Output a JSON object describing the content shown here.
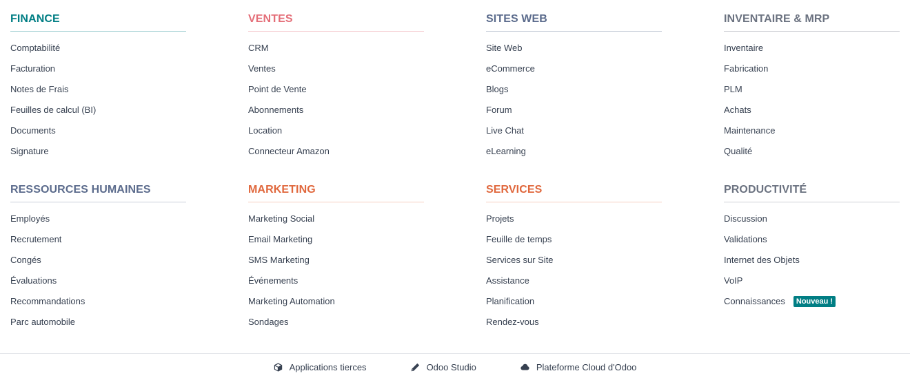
{
  "sections": [
    {
      "title": "FINANCE",
      "color": "#017e84",
      "items": [
        "Comptabilité",
        "Facturation",
        "Notes de Frais",
        "Feuilles de calcul (BI)",
        "Documents",
        "Signature"
      ]
    },
    {
      "title": "VENTES",
      "color": "#e46e78",
      "items": [
        "CRM",
        "Ventes",
        "Point de Vente",
        "Abonnements",
        "Location",
        "Connecteur Amazon"
      ]
    },
    {
      "title": "SITES WEB",
      "color": "#5b6b8c",
      "items": [
        "Site Web",
        "eCommerce",
        "Blogs",
        "Forum",
        "Live Chat",
        "eLearning"
      ]
    },
    {
      "title": "INVENTAIRE & MRP",
      "color": "#6b7280",
      "items": [
        "Inventaire",
        "Fabrication",
        "PLM",
        "Achats",
        "Maintenance",
        "Qualité"
      ]
    },
    {
      "title": "RESSOURCES HUMAINES",
      "color": "#5b6b8c",
      "items": [
        "Employés",
        "Recrutement",
        "Congés",
        "Évaluations",
        "Recommandations",
        "Parc automobile"
      ]
    },
    {
      "title": "MARKETING",
      "color": "#e0673c",
      "items": [
        "Marketing Social",
        "Email Marketing",
        "SMS Marketing",
        "Événements",
        "Marketing Automation",
        "Sondages"
      ]
    },
    {
      "title": "SERVICES",
      "color": "#e0673c",
      "items": [
        "Projets",
        "Feuille de temps",
        "Services sur Site",
        "Assistance",
        "Planification",
        "Rendez-vous"
      ]
    },
    {
      "title": "PRODUCTIVITÉ",
      "color": "#6b7280",
      "items": [
        "Discussion",
        "Validations",
        "Internet des Objets",
        "VoIP",
        "Connaissances"
      ]
    }
  ],
  "badge": {
    "label": "Nouveau !",
    "color": "#017e84"
  },
  "footer": {
    "third_party": {
      "label": "Applications tierces",
      "icon": "cube-icon"
    },
    "studio": {
      "label": "Odoo Studio",
      "icon": "pencil-icon"
    },
    "cloud": {
      "label": "Plateforme Cloud d'Odoo",
      "icon": "cloud-icon"
    }
  }
}
